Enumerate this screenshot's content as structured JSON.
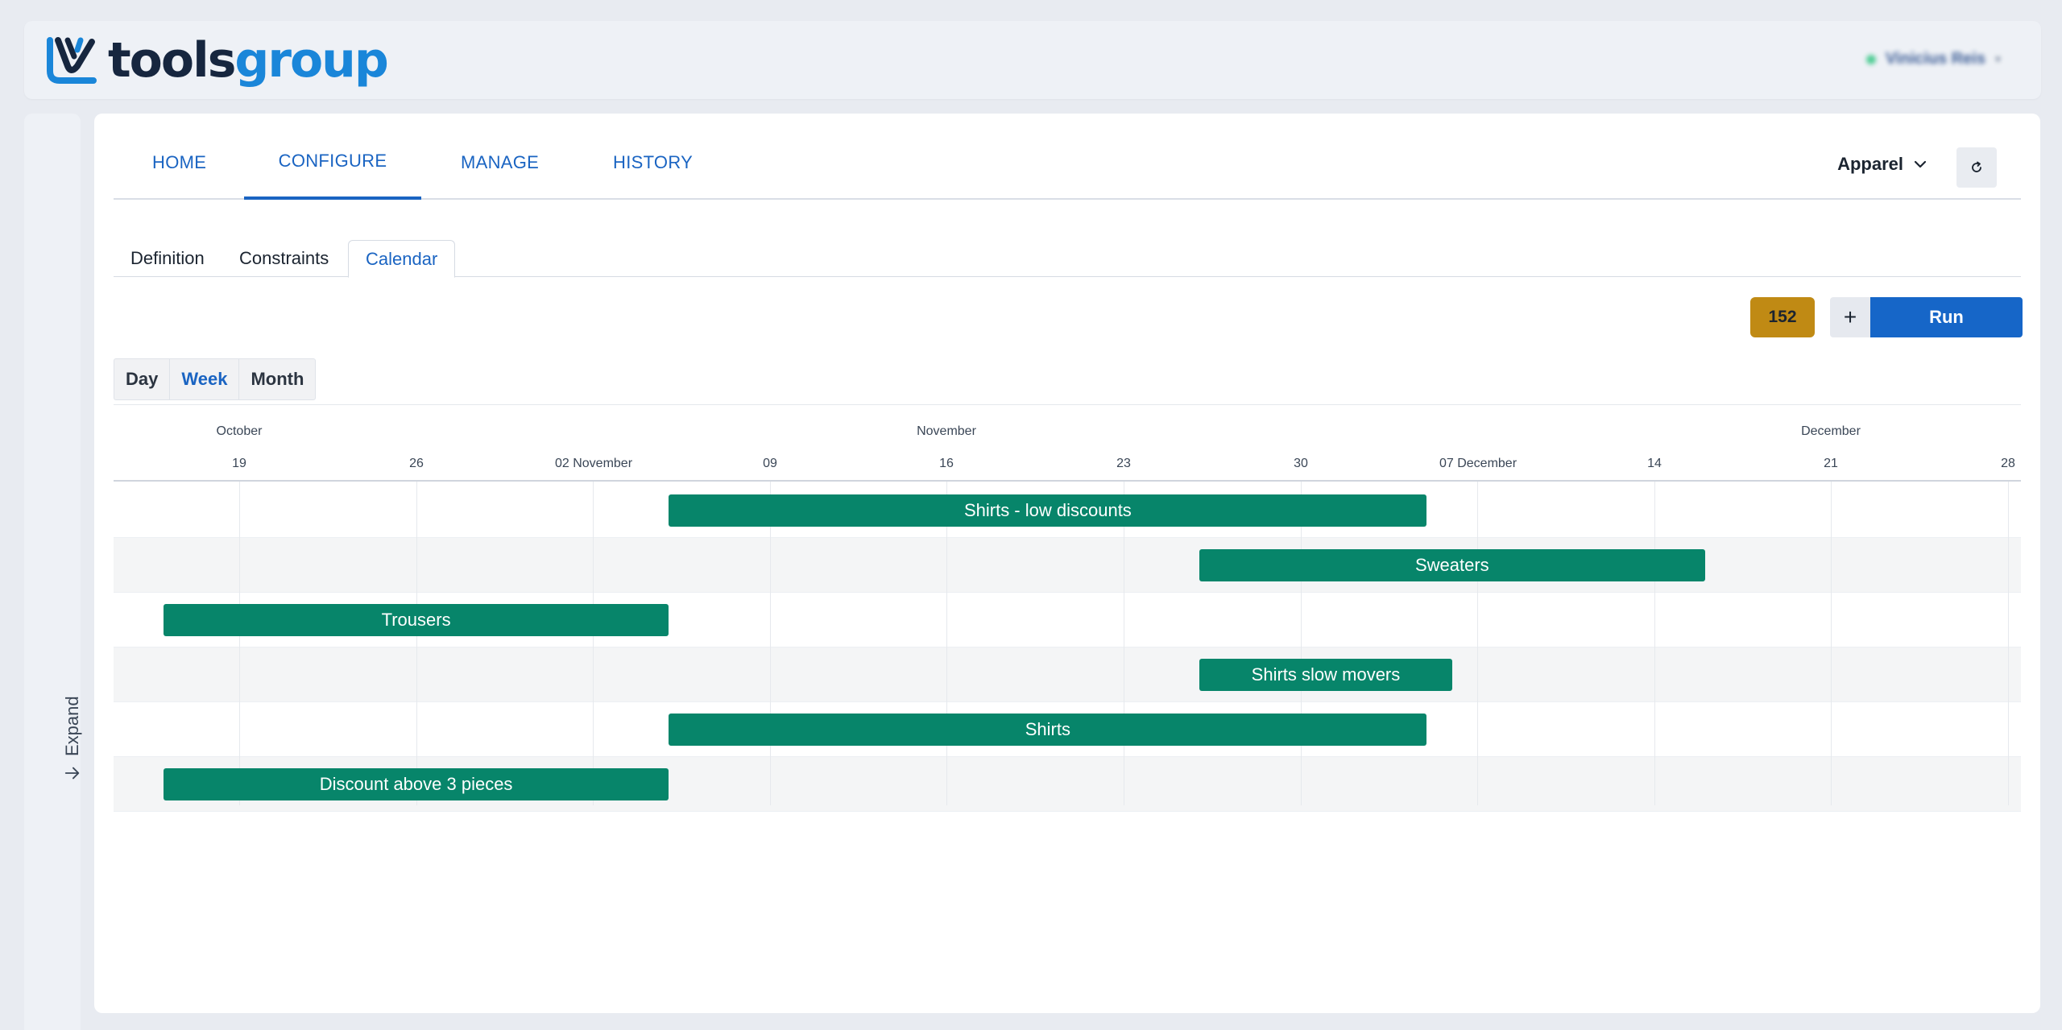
{
  "header": {
    "logo": {
      "part1": "tools",
      "part2": "group",
      "icon": "toolsgroup-logo-icon"
    },
    "user": {
      "name": "Vinicius Reis"
    }
  },
  "sidebar": {
    "expand_label": "Expand",
    "icon": "arrow-right-icon"
  },
  "topnav": {
    "tabs": [
      {
        "label": "HOME"
      },
      {
        "label": "CONFIGURE",
        "active": true
      },
      {
        "label": "MANAGE"
      },
      {
        "label": "HISTORY"
      }
    ],
    "business_unit": "Apparel",
    "refresh_icon": "refresh-icon"
  },
  "subtabs": [
    {
      "label": "Definition"
    },
    {
      "label": "Constraints"
    },
    {
      "label": "Calendar",
      "active": true
    }
  ],
  "actions": {
    "count": "152",
    "plus_label": "+",
    "run_label": "Run"
  },
  "views": [
    {
      "label": "Day"
    },
    {
      "label": "Week",
      "active": true
    },
    {
      "label": "Month"
    }
  ],
  "calendar": {
    "months": [
      "October",
      "November",
      "December"
    ],
    "weeks": [
      "19",
      "26",
      "02 November",
      "09",
      "16",
      "23",
      "30",
      "07 December",
      "14",
      "21",
      "28"
    ],
    "events": [
      {
        "label": "Shirts - low discounts",
        "start": "2020-11-05",
        "end": "2020-12-05"
      },
      {
        "label": "Sweaters",
        "start": "2020-11-26",
        "end": "2020-12-16"
      },
      {
        "label": "Trousers",
        "start": "2020-10-16",
        "end": "2020-11-05"
      },
      {
        "label": "Shirts slow movers",
        "start": "2020-11-26",
        "end": "2020-12-06"
      },
      {
        "label": "Shirts",
        "start": "2020-11-05",
        "end": "2020-12-05"
      },
      {
        "label": "Discount above 3 pieces",
        "start": "2020-10-16",
        "end": "2020-11-05"
      }
    ]
  }
}
